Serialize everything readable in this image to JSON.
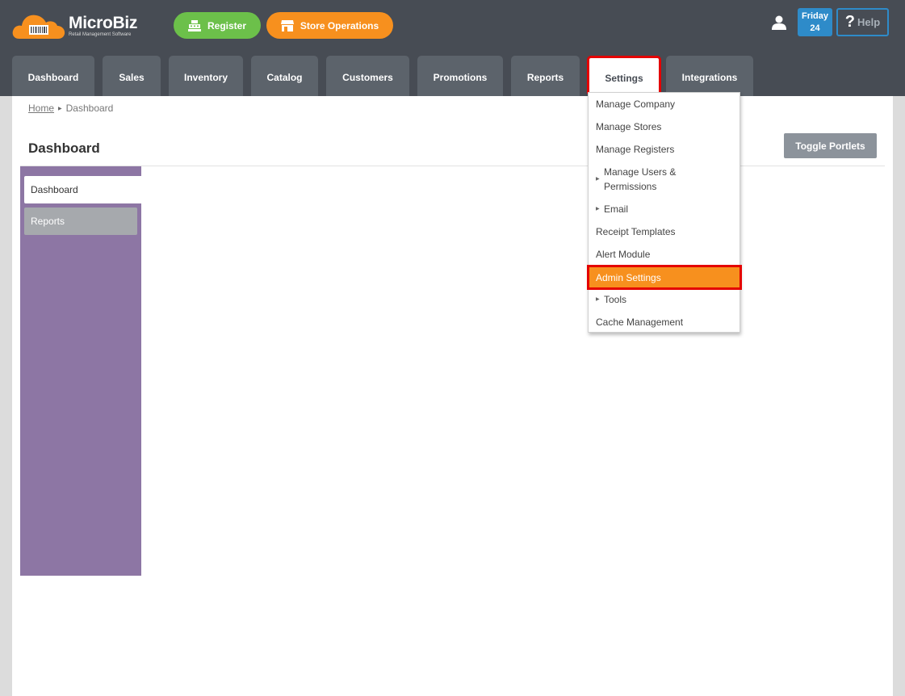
{
  "header": {
    "logo_text": "MicroBiz",
    "logo_tagline": "Retail Management Software",
    "register_label": "Register",
    "store_ops_label": "Store Operations",
    "date_day": "Friday",
    "date_num": "24",
    "help_label": "Help",
    "help_symbol": "?"
  },
  "tabs": [
    {
      "label": "Dashboard"
    },
    {
      "label": "Sales"
    },
    {
      "label": "Inventory"
    },
    {
      "label": "Catalog"
    },
    {
      "label": "Customers"
    },
    {
      "label": "Promotions"
    },
    {
      "label": "Reports"
    },
    {
      "label": "Settings"
    },
    {
      "label": "Integrations"
    }
  ],
  "settings_menu": [
    {
      "label": "Manage Company"
    },
    {
      "label": "Manage Stores"
    },
    {
      "label": "Manage Registers"
    },
    {
      "label": "Manage Users &",
      "label2": "Permissions"
    },
    {
      "label": "Email"
    },
    {
      "label": "Receipt Templates"
    },
    {
      "label": "Alert Module"
    },
    {
      "label": "Admin Settings"
    },
    {
      "label": "Tools"
    },
    {
      "label": "Cache Management"
    }
  ],
  "breadcrumb": {
    "home": "Home",
    "current": "Dashboard"
  },
  "page": {
    "title": "Dashboard",
    "toggle_label": "Toggle Portlets"
  },
  "sidebar": {
    "items": [
      {
        "label": "Dashboard"
      },
      {
        "label": "Reports"
      }
    ]
  },
  "colors": {
    "header_bg": "#474c54",
    "tab_bg": "#5c636b",
    "register_green": "#6cc04a",
    "accent_orange": "#f7901e",
    "date_blue": "#2e8bc9",
    "sidebar_purple": "#8d76a4",
    "highlight_red": "#e40000"
  }
}
